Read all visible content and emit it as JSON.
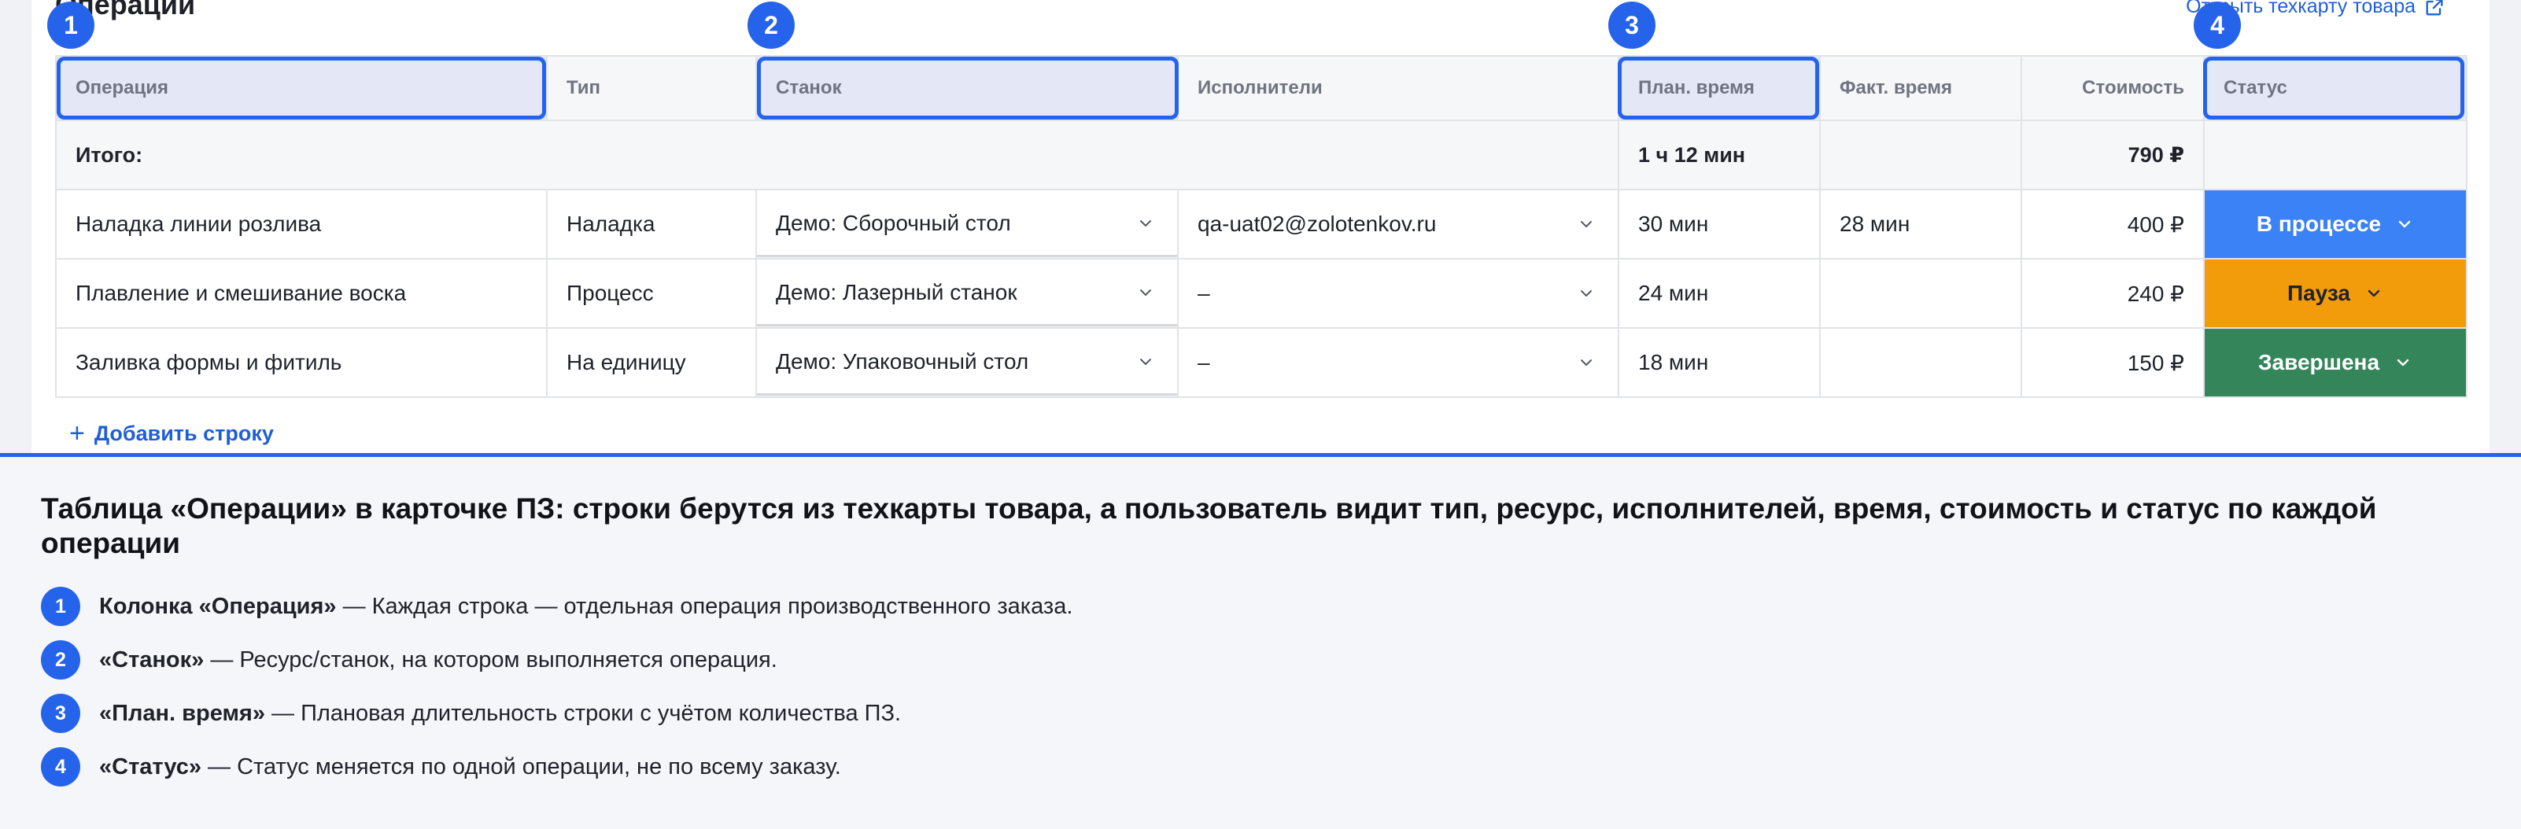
{
  "section": {
    "title": "Операции",
    "open_link": "Открыть техкарту товара"
  },
  "table": {
    "headers": {
      "operation": "Операция",
      "type": "Тип",
      "machine": "Станок",
      "executors": "Исполнители",
      "plan_time": "План. время",
      "fact_time": "Факт. время",
      "cost": "Стоимость",
      "status": "Статус"
    },
    "total": {
      "label": "Итого:",
      "plan_time": "1 ч 12 мин",
      "cost": "790 ₽"
    },
    "rows": [
      {
        "operation": "Наладка линии розлива",
        "type": "Наладка",
        "machine": "Демо: Сборочный стол",
        "executors": "qa-uat02@zolotenkov.ru",
        "plan_time": "30 мин",
        "fact_time": "28 мин",
        "cost": "400 ₽",
        "status": "В процессе"
      },
      {
        "operation": "Плавление и смешивание воска",
        "type": "Процесс",
        "machine": "Демо: Лазерный станок",
        "executors": "–",
        "plan_time": "24 мин",
        "fact_time": "",
        "cost": "240 ₽",
        "status": "Пауза"
      },
      {
        "operation": "Заливка формы и фитиль",
        "type": "На единицу",
        "machine": "Демо: Упаковочный стол",
        "executors": "–",
        "plan_time": "18 мин",
        "fact_time": "",
        "cost": "150 ₽",
        "status": "Завершена"
      }
    ],
    "add_row": "Добавить строку"
  },
  "badges": [
    "1",
    "2",
    "3",
    "4"
  ],
  "panel": {
    "title": "Таблица «Операции» в карточке ПЗ: строки берутся из техкарты товара, а пользователь видит тип, ресурс, исполнителей, время, стоимость и статус по каждой операции",
    "notes": [
      {
        "num": "1",
        "term": "Колонка «Операция»",
        "text": " — Каждая строка — отдельная операция производственного заказа."
      },
      {
        "num": "2",
        "term": "«Станок»",
        "text": " — Ресурс/станок, на котором выполняется операция."
      },
      {
        "num": "3",
        "term": "«План. время»",
        "text": " — Плановая длительность строки с учётом количества ПЗ."
      },
      {
        "num": "4",
        "term": "«Статус»",
        "text": " — Статус меняется по одной операции, не по всему заказу."
      }
    ]
  },
  "colors": {
    "accent": "#2563eb",
    "status_in_progress": "#3b82f6",
    "status_pause": "#f39c0b",
    "status_done": "#35855a"
  },
  "icons": {
    "dropdown": "chevron-down-icon",
    "external": "external-link-icon",
    "add": "plus-icon"
  }
}
